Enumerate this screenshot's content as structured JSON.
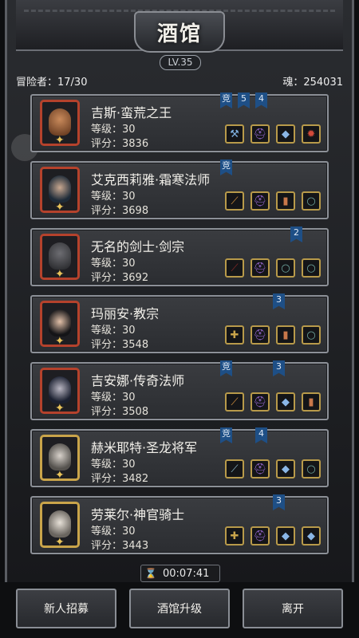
{
  "header": {
    "title": "酒馆",
    "level": "LV.35"
  },
  "stats": {
    "adventurers_label": "冒险者：17/30",
    "soul_label": "魂：254031"
  },
  "heroes": [
    {
      "name": "吉斯·蛮荒之王",
      "level": "等级：30",
      "score": "评分：3836",
      "flags": [
        "竞",
        "5",
        "4"
      ],
      "frame": "red"
    },
    {
      "name": "艾克西莉雅·霜寒法师",
      "level": "等级：30",
      "score": "评分：3698",
      "flags": [
        "竞"
      ],
      "frame": "red"
    },
    {
      "name": "无名的剑士·剑宗",
      "level": "等级：30",
      "score": "评分：3692",
      "flags": [
        "2"
      ],
      "frame": "red"
    },
    {
      "name": "玛丽安·教宗",
      "level": "等级：30",
      "score": "评分：3548",
      "flags": [
        "3"
      ],
      "frame": "red"
    },
    {
      "name": "吉安娜·传奇法师",
      "level": "等级：30",
      "score": "评分：3508",
      "flags": [
        "竞",
        "3"
      ],
      "frame": "red"
    },
    {
      "name": "赫米耶特·圣龙将军",
      "level": "等级：30",
      "score": "评分：3482",
      "flags": [
        "竞",
        "4"
      ],
      "frame": "gold"
    },
    {
      "name": "劳莱尔·神官骑士",
      "level": "等级：30",
      "score": "评分：3443",
      "flags": [
        "3"
      ],
      "frame": "gold"
    }
  ],
  "timer": "00:07:41",
  "buttons": {
    "recruit": "新人招募",
    "upgrade": "酒馆升级",
    "leave": "离开"
  }
}
